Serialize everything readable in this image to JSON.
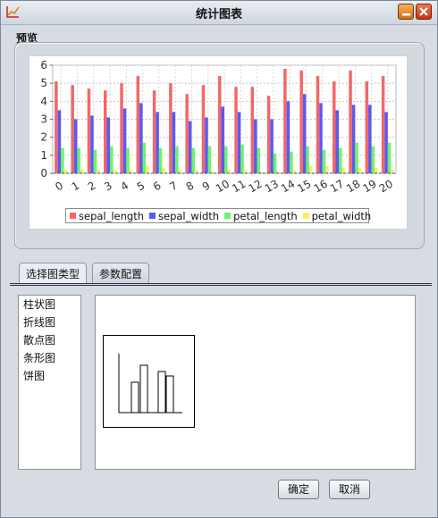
{
  "window": {
    "title": "统计图表",
    "minimize_icon": "minimize-icon",
    "close_icon": "close-icon"
  },
  "preview": {
    "label": "预览"
  },
  "chart_data": {
    "type": "bar",
    "categories": [
      "0",
      "1",
      "2",
      "3",
      "4",
      "5",
      "6",
      "7",
      "8",
      "9",
      "10",
      "11",
      "12",
      "13",
      "14",
      "15",
      "16",
      "17",
      "18",
      "19",
      "20"
    ],
    "series": [
      {
        "name": "sepal_length",
        "color": "#f26868",
        "values": [
          5.1,
          4.9,
          4.7,
          4.6,
          5.0,
          5.4,
          4.6,
          5.0,
          4.4,
          4.9,
          5.4,
          4.8,
          4.8,
          4.3,
          5.8,
          5.7,
          5.4,
          5.1,
          5.7,
          5.1,
          5.4
        ]
      },
      {
        "name": "sepal_width",
        "color": "#5a5af2",
        "values": [
          3.5,
          3.0,
          3.2,
          3.1,
          3.6,
          3.9,
          3.4,
          3.4,
          2.9,
          3.1,
          3.7,
          3.4,
          3.0,
          3.0,
          4.0,
          4.4,
          3.9,
          3.5,
          3.8,
          3.8,
          3.4
        ]
      },
      {
        "name": "petal_length",
        "color": "#6cf26c",
        "values": [
          1.4,
          1.4,
          1.3,
          1.5,
          1.4,
          1.7,
          1.4,
          1.5,
          1.4,
          1.5,
          1.5,
          1.6,
          1.4,
          1.1,
          1.2,
          1.5,
          1.3,
          1.4,
          1.7,
          1.5,
          1.7
        ]
      },
      {
        "name": "petal_width",
        "color": "#f2f25a",
        "values": [
          0.2,
          0.2,
          0.2,
          0.2,
          0.2,
          0.4,
          0.3,
          0.2,
          0.2,
          0.1,
          0.2,
          0.2,
          0.1,
          0.1,
          0.2,
          0.4,
          0.4,
          0.3,
          0.3,
          0.3,
          0.2
        ]
      }
    ],
    "yticks": [
      "0",
      "1",
      "2",
      "3",
      "4",
      "5",
      "6"
    ],
    "ylim": [
      0,
      6
    ],
    "grid": true,
    "legend_position": "bottom"
  },
  "tabs": [
    {
      "label": "选择图类型",
      "active": true
    },
    {
      "label": "参数配置",
      "active": false
    }
  ],
  "chart_types": [
    "柱状图",
    "折线图",
    "散点图",
    "条形图",
    "饼图"
  ],
  "buttons": {
    "ok": "确定",
    "cancel": "取消"
  }
}
